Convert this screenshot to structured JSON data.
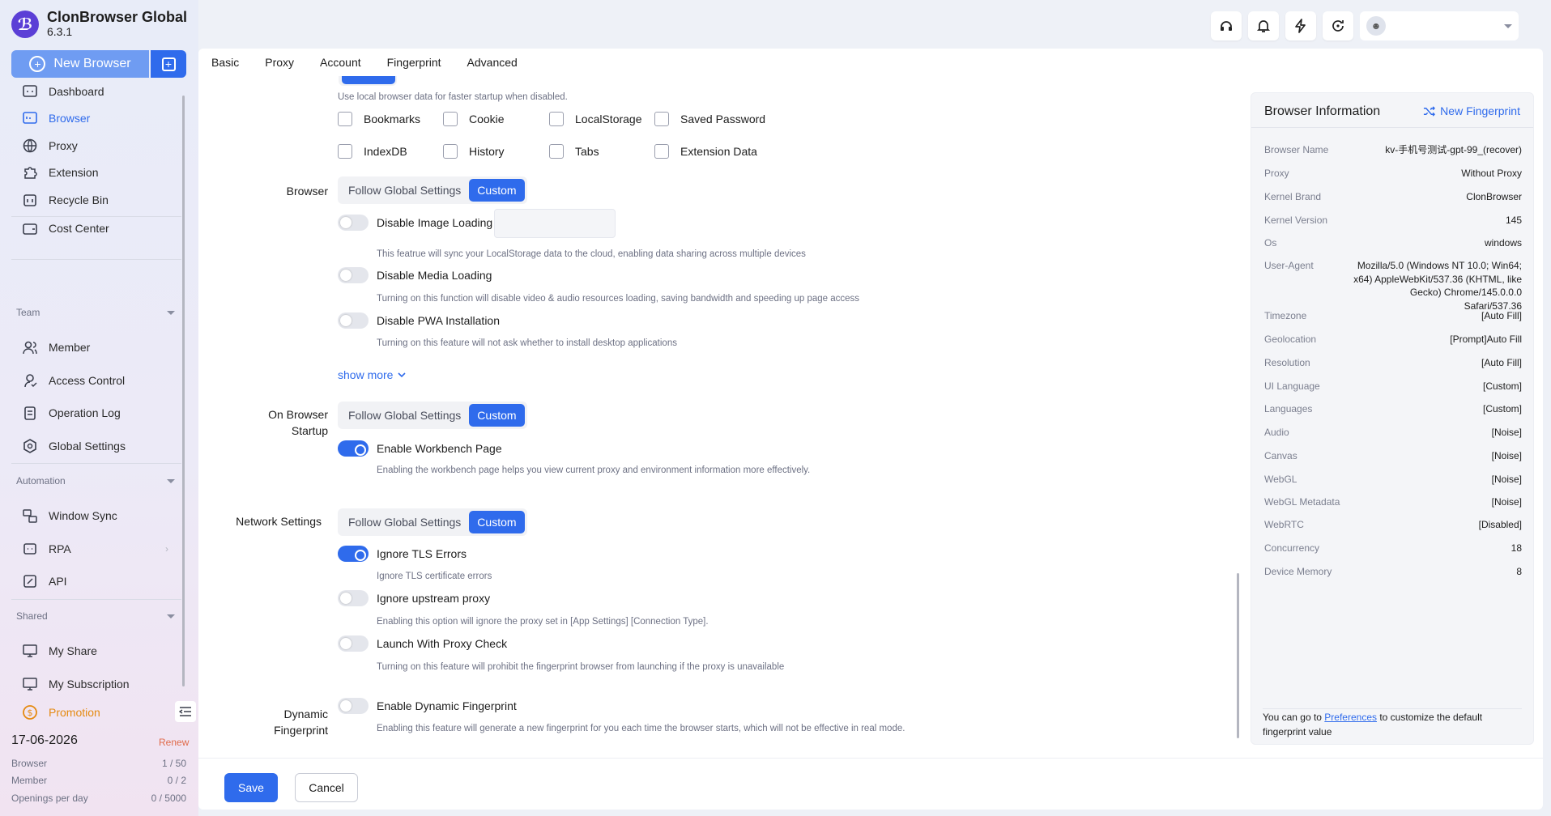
{
  "app": {
    "name": "ClonBrowser Global",
    "version": "6.3.1"
  },
  "sidebar": {
    "new_browser_label": "New Browser",
    "items": [
      {
        "label": "Dashboard",
        "icon": "dashboard-icon"
      },
      {
        "label": "Browser",
        "icon": "browser-icon",
        "active": true
      },
      {
        "label": "Proxy",
        "icon": "globe-icon"
      },
      {
        "label": "Extension",
        "icon": "puzzle-icon"
      },
      {
        "label": "Recycle Bin",
        "icon": "trash-icon"
      },
      {
        "label": "Cost Center",
        "icon": "wallet-icon"
      }
    ],
    "team_label": "Team",
    "team_items": [
      {
        "label": "Member",
        "icon": "users-icon"
      },
      {
        "label": "Access Control",
        "icon": "access-icon"
      },
      {
        "label": "Operation Log",
        "icon": "log-icon"
      },
      {
        "label": "Global Settings",
        "icon": "settings-icon"
      }
    ],
    "automation_label": "Automation",
    "automation_items": [
      {
        "label": "Window Sync",
        "icon": "sync-icon"
      },
      {
        "label": "RPA",
        "icon": "rpa-icon"
      },
      {
        "label": "API",
        "icon": "api-icon"
      }
    ],
    "shared_label": "Shared",
    "shared_items": [
      {
        "label": "My Share",
        "icon": "share-icon"
      },
      {
        "label": "My Subscription",
        "icon": "subscription-icon"
      }
    ],
    "promotion_label": "Promotion",
    "subscription": {
      "date": "17-06-2026",
      "renew_label": "Renew",
      "stats": [
        {
          "label": "Browser",
          "value": "1 / 50"
        },
        {
          "label": "Member",
          "value": "0 / 2"
        },
        {
          "label": "Openings per day",
          "value": "0 / 5000"
        }
      ]
    }
  },
  "tabs": [
    "Basic",
    "Proxy",
    "Account",
    "Fingerprint",
    "Advanced"
  ],
  "form": {
    "local_data_hint": "Use local browser data for faster startup when disabled.",
    "checkboxes_row1": [
      "Bookmarks",
      "Cookie",
      "LocalStorage",
      "Saved Password"
    ],
    "checkboxes_row2": [
      "IndexDB",
      "History",
      "Tabs",
      "Extension Data"
    ],
    "browser_label": "Browser",
    "follow_global": "Follow Global Settings",
    "custom": "Custom",
    "disable_image": {
      "label": "Disable Image Loading",
      "hint": "This featrue will sync your LocalStorage data to the cloud, enabling data sharing across multiple devices",
      "on": false
    },
    "disable_media": {
      "label": "Disable Media Loading",
      "hint": "Turning on this function will disable video & audio resources loading, saving bandwidth and speeding up page access",
      "on": false
    },
    "disable_pwa": {
      "label": "Disable PWA Installation",
      "hint": "Turning on this feature will not ask whether to install desktop applications",
      "on": false
    },
    "show_more": "show more",
    "startup_label_1": "On Browser",
    "startup_label_2": "Startup",
    "workbench": {
      "label": "Enable Workbench Page",
      "hint": "Enabling the workbench page helps you view current proxy and environment information more effectively.",
      "on": true
    },
    "network_label": "Network Settings",
    "tls": {
      "label": "Ignore TLS Errors",
      "hint": "Ignore TLS certificate errors",
      "on": true
    },
    "upstream": {
      "label": "Ignore upstream proxy",
      "hint": "Enabling this option will ignore the proxy set in [App Settings] [Connection Type].",
      "on": false
    },
    "proxy_check": {
      "label": "Launch With Proxy Check",
      "hint": "Turning on this feature will prohibit the fingerprint browser from launching if the proxy is unavailable",
      "on": false
    },
    "dynamic_label_1": "Dynamic",
    "dynamic_label_2": "Fingerprint",
    "dynamic": {
      "label": "Enable Dynamic Fingerprint",
      "hint": "Enabling this feature will generate a new fingerprint for you each time the browser starts, which will not be effective in real mode.",
      "on": false
    }
  },
  "footer": {
    "save_label": "Save",
    "cancel_label": "Cancel"
  },
  "info": {
    "title": "Browser Information",
    "new_fingerprint": "New Fingerprint",
    "rows": [
      {
        "key": "Browser Name",
        "value": "kv-手机号测试-gpt-99_(recover)"
      },
      {
        "key": "Proxy",
        "value": "Without Proxy"
      },
      {
        "key": "Kernel Brand",
        "value": "ClonBrowser"
      },
      {
        "key": "Kernel Version",
        "value": "145"
      },
      {
        "key": "Os",
        "value": "windows"
      },
      {
        "key": "User-Agent",
        "value": "Mozilla/5.0 (Windows NT 10.0; Win64; x64) AppleWebKit/537.36 (KHTML, like Gecko) Chrome/145.0.0.0 Safari/537.36"
      },
      {
        "key": "Timezone",
        "value": "[Auto Fill]"
      },
      {
        "key": "Geolocation",
        "value": "[Prompt]Auto Fill"
      },
      {
        "key": "Resolution",
        "value": "[Auto Fill]"
      },
      {
        "key": "UI Language",
        "value": "[Custom]"
      },
      {
        "key": "Languages",
        "value": "[Custom]"
      },
      {
        "key": "Audio",
        "value": "[Noise]"
      },
      {
        "key": "Canvas",
        "value": "[Noise]"
      },
      {
        "key": "WebGL",
        "value": "[Noise]"
      },
      {
        "key": "WebGL Metadata",
        "value": "[Noise]"
      },
      {
        "key": "WebRTC",
        "value": "[Disabled]"
      },
      {
        "key": "Concurrency",
        "value": "18"
      },
      {
        "key": "Device Memory",
        "value": "8"
      }
    ],
    "foot_prefix": "You can go to ",
    "foot_link": "Preferences",
    "foot_suffix": " to customize the default fingerprint value"
  },
  "colors": {
    "accent": "#2f6bec",
    "promotion": "#e58a11",
    "renew": "#e06a4a"
  }
}
